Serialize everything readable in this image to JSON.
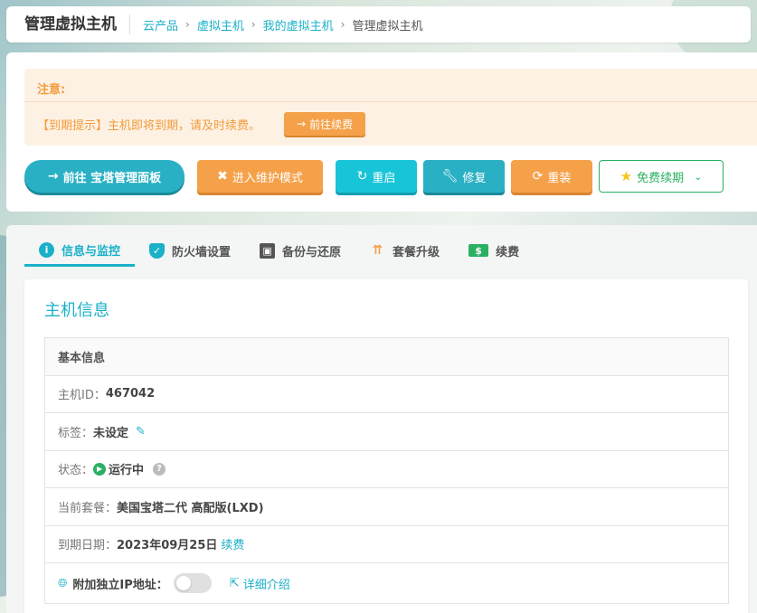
{
  "header": {
    "title": "管理虚拟主机",
    "breadcrumb": [
      "云产品",
      "虚拟主机",
      "我的虚拟主机",
      "管理虚拟主机"
    ]
  },
  "notice": {
    "title": "注意:",
    "message": "【到期提示】主机即将到期，请及时续费。",
    "renew_button": "前往续费"
  },
  "actions": {
    "bt_panel": "前往 宝塔管理面板",
    "maintenance": "进入维护模式",
    "restart": "重启",
    "repair": "修复",
    "reinstall": "重装",
    "free_renew": "免费续期"
  },
  "tabs": [
    {
      "label": "信息与监控",
      "icon": "info-icon",
      "active": true
    },
    {
      "label": "防火墙设置",
      "icon": "shield-icon"
    },
    {
      "label": "备份与还原",
      "icon": "copy-icon"
    },
    {
      "label": "套餐升级",
      "icon": "double-up-arrow-icon"
    },
    {
      "label": "续费",
      "icon": "money-icon"
    }
  ],
  "host_info": {
    "card_title": "主机信息",
    "section_title": "基本信息",
    "id_label": "主机ID：",
    "id_value": "467042",
    "tag_label": "标签：",
    "tag_value": "未设定",
    "status_label": "状态：",
    "status_value": "运行中",
    "plan_label": "当前套餐：",
    "plan_value": "美国宝塔二代 高配版(LXD)",
    "expire_label": "到期日期：",
    "expire_value": "2023年09月25日",
    "renew_link": "续费",
    "ip_label": "附加独立IP地址：",
    "ip_enabled": false,
    "detail_link": "详细介绍"
  },
  "colors": {
    "primary": "#1ab0c8",
    "orange": "#f5a14a",
    "cyan": "#18c4d8",
    "green": "#2ab062"
  }
}
